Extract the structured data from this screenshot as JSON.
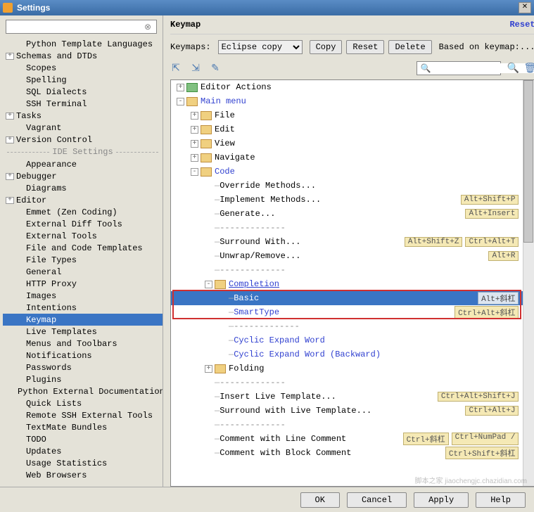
{
  "title": "Settings",
  "sidebar": {
    "search_placeholder": "",
    "items_top": [
      {
        "label": "Python Template Languages",
        "toggle": "",
        "indent": 1
      },
      {
        "label": "Schemas and DTDs",
        "toggle": "+",
        "indent": 0
      },
      {
        "label": "Scopes",
        "toggle": "",
        "indent": 1
      },
      {
        "label": "Spelling",
        "toggle": "",
        "indent": 1
      },
      {
        "label": "SQL Dialects",
        "toggle": "",
        "indent": 1
      },
      {
        "label": "SSH Terminal",
        "toggle": "",
        "indent": 1
      },
      {
        "label": "Tasks",
        "toggle": "+",
        "indent": 0
      },
      {
        "label": "Vagrant",
        "toggle": "",
        "indent": 1
      },
      {
        "label": "Version Control",
        "toggle": "+",
        "indent": 0
      }
    ],
    "divider": "IDE Settings",
    "items_bottom": [
      {
        "label": "Appearance",
        "toggle": "",
        "indent": 1
      },
      {
        "label": "Debugger",
        "toggle": "+",
        "indent": 0
      },
      {
        "label": "Diagrams",
        "toggle": "",
        "indent": 1
      },
      {
        "label": "Editor",
        "toggle": "+",
        "indent": 0
      },
      {
        "label": "Emmet (Zen Coding)",
        "toggle": "",
        "indent": 1
      },
      {
        "label": "External Diff Tools",
        "toggle": "",
        "indent": 1
      },
      {
        "label": "External Tools",
        "toggle": "",
        "indent": 1
      },
      {
        "label": "File and Code Templates",
        "toggle": "",
        "indent": 1
      },
      {
        "label": "File Types",
        "toggle": "",
        "indent": 1
      },
      {
        "label": "General",
        "toggle": "",
        "indent": 1
      },
      {
        "label": "HTTP Proxy",
        "toggle": "",
        "indent": 1
      },
      {
        "label": "Images",
        "toggle": "",
        "indent": 1
      },
      {
        "label": "Intentions",
        "toggle": "",
        "indent": 1
      },
      {
        "label": "Keymap",
        "toggle": "",
        "indent": 1,
        "selected": true
      },
      {
        "label": "Live Templates",
        "toggle": "",
        "indent": 1
      },
      {
        "label": "Menus and Toolbars",
        "toggle": "",
        "indent": 1
      },
      {
        "label": "Notifications",
        "toggle": "",
        "indent": 1
      },
      {
        "label": "Passwords",
        "toggle": "",
        "indent": 1
      },
      {
        "label": "Plugins",
        "toggle": "",
        "indent": 1
      },
      {
        "label": "Python External Documentation",
        "toggle": "",
        "indent": 1
      },
      {
        "label": "Quick Lists",
        "toggle": "",
        "indent": 1
      },
      {
        "label": "Remote SSH External Tools",
        "toggle": "",
        "indent": 1
      },
      {
        "label": "TextMate Bundles",
        "toggle": "",
        "indent": 1
      },
      {
        "label": "TODO",
        "toggle": "",
        "indent": 1
      },
      {
        "label": "Updates",
        "toggle": "",
        "indent": 1
      },
      {
        "label": "Usage Statistics",
        "toggle": "",
        "indent": 1
      },
      {
        "label": "Web Browsers",
        "toggle": "",
        "indent": 1
      }
    ]
  },
  "main": {
    "header_title": "Keymap",
    "reset_label": "Reset",
    "keymaps_label": "Keymaps:",
    "keymap_selected": "Eclipse copy",
    "copy_btn": "Copy",
    "reset_btn": "Reset",
    "delete_btn": "Delete",
    "based_on": "Based on keymap:...",
    "tree": [
      {
        "depth": 0,
        "toggle": "+",
        "icon": "action",
        "label": "Editor Actions",
        "link": false
      },
      {
        "depth": 0,
        "toggle": "-",
        "icon": "folder",
        "label": "Main menu",
        "link": true
      },
      {
        "depth": 1,
        "toggle": "+",
        "icon": "folder",
        "label": "File",
        "link": false
      },
      {
        "depth": 1,
        "toggle": "+",
        "icon": "folder",
        "label": "Edit",
        "link": false
      },
      {
        "depth": 1,
        "toggle": "+",
        "icon": "folder",
        "label": "View",
        "link": false
      },
      {
        "depth": 1,
        "toggle": "+",
        "icon": "folder",
        "label": "Navigate",
        "link": false
      },
      {
        "depth": 1,
        "toggle": "-",
        "icon": "folder",
        "label": "Code",
        "link": true
      },
      {
        "depth": 2,
        "toggle": "",
        "icon": "",
        "label": "Override Methods...",
        "link": false
      },
      {
        "depth": 2,
        "toggle": "",
        "icon": "",
        "label": "Implement Methods...",
        "link": false,
        "shortcuts": [
          "Alt+Shift+P"
        ]
      },
      {
        "depth": 2,
        "toggle": "",
        "icon": "",
        "label": "Generate...",
        "link": false,
        "shortcuts": [
          "Alt+Insert"
        ]
      },
      {
        "depth": 2,
        "toggle": "",
        "icon": "",
        "label": "-------------",
        "link": false,
        "dashed": true
      },
      {
        "depth": 2,
        "toggle": "",
        "icon": "",
        "label": "Surround With...",
        "link": false,
        "shortcuts": [
          "Alt+Shift+Z",
          "Ctrl+Alt+T"
        ]
      },
      {
        "depth": 2,
        "toggle": "",
        "icon": "",
        "label": "Unwrap/Remove...",
        "link": false,
        "shortcuts": [
          "Alt+R"
        ]
      },
      {
        "depth": 2,
        "toggle": "",
        "icon": "",
        "label": "-------------",
        "link": false,
        "dashed": true
      },
      {
        "depth": 2,
        "toggle": "-",
        "icon": "folder",
        "label": "Completion",
        "link": true,
        "underline": true
      },
      {
        "depth": 3,
        "toggle": "",
        "icon": "",
        "label": "Basic",
        "link": true,
        "selected": true,
        "shortcuts": [
          "Alt+斜杠"
        ]
      },
      {
        "depth": 3,
        "toggle": "",
        "icon": "",
        "label": "SmartType",
        "link": true,
        "shortcuts": [
          "Ctrl+Alt+斜杠"
        ]
      },
      {
        "depth": 3,
        "toggle": "",
        "icon": "",
        "label": "-------------",
        "link": false,
        "dashed": true
      },
      {
        "depth": 3,
        "toggle": "",
        "icon": "",
        "label": "Cyclic Expand Word",
        "link": true
      },
      {
        "depth": 3,
        "toggle": "",
        "icon": "",
        "label": "Cyclic Expand Word (Backward)",
        "link": true
      },
      {
        "depth": 2,
        "toggle": "+",
        "icon": "folder",
        "label": "Folding",
        "link": false
      },
      {
        "depth": 2,
        "toggle": "",
        "icon": "",
        "label": "-------------",
        "link": false,
        "dashed": true
      },
      {
        "depth": 2,
        "toggle": "",
        "icon": "",
        "label": "Insert Live Template...",
        "link": false,
        "shortcuts": [
          "Ctrl+Alt+Shift+J"
        ]
      },
      {
        "depth": 2,
        "toggle": "",
        "icon": "",
        "label": "Surround with Live Template...",
        "link": false,
        "shortcuts": [
          "Ctrl+Alt+J"
        ]
      },
      {
        "depth": 2,
        "toggle": "",
        "icon": "",
        "label": "-------------",
        "link": false,
        "dashed": true
      },
      {
        "depth": 2,
        "toggle": "",
        "icon": "",
        "label": "Comment with Line Comment",
        "link": false,
        "shortcuts": [
          "Ctrl+斜杠",
          "Ctrl+NumPad /"
        ]
      },
      {
        "depth": 2,
        "toggle": "",
        "icon": "",
        "label": "Comment with Block Comment",
        "link": false,
        "shortcuts": [
          "Ctrl+Shift+斜杠"
        ]
      }
    ]
  },
  "buttons": {
    "ok": "OK",
    "cancel": "Cancel",
    "apply": "Apply",
    "help": "Help"
  },
  "watermark": "脚本之家 jiaochengjc.chazidian.com"
}
